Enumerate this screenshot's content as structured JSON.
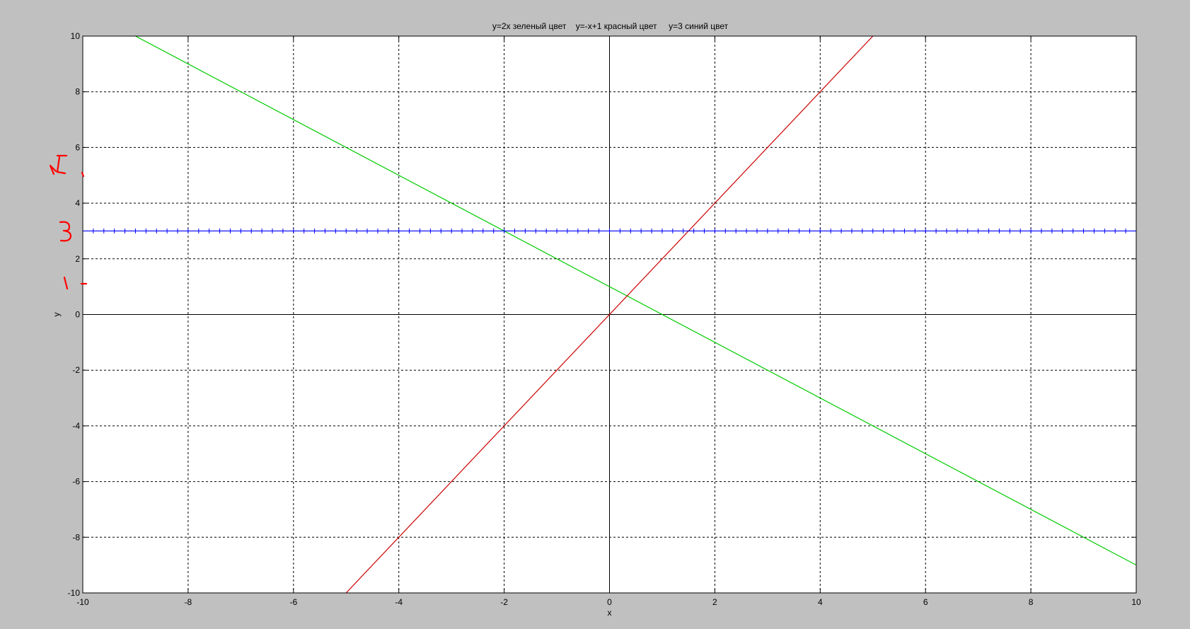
{
  "chart_data": {
    "type": "line",
    "title": "y=2x зеленый цвет    y=-x+1 красный цвет     y=3 синий цвет",
    "xlabel": "x",
    "ylabel": "y",
    "xlim": [
      -10,
      10
    ],
    "ylim": [
      -10,
      10
    ],
    "x_ticks": [
      -10,
      -8,
      -6,
      -4,
      -2,
      0,
      2,
      4,
      6,
      8,
      10
    ],
    "y_ticks": [
      -10,
      -8,
      -6,
      -4,
      -2,
      0,
      2,
      4,
      6,
      8,
      10
    ],
    "grid": true,
    "grid_style": "dashed",
    "series": [
      {
        "color": "#00cc00",
        "marker": "none",
        "x": [
          -10,
          10
        ],
        "y": [
          11,
          -9
        ]
      },
      {
        "color": "#cc0000",
        "marker": "none",
        "x": [
          -5,
          5
        ],
        "y": [
          -10,
          10
        ]
      },
      {
        "color": "#0000ff",
        "marker": "+",
        "x": [
          -10,
          10
        ],
        "y": [
          3,
          3
        ],
        "marker_step": 0.2
      }
    ],
    "annotation_color": "#ff0000"
  }
}
